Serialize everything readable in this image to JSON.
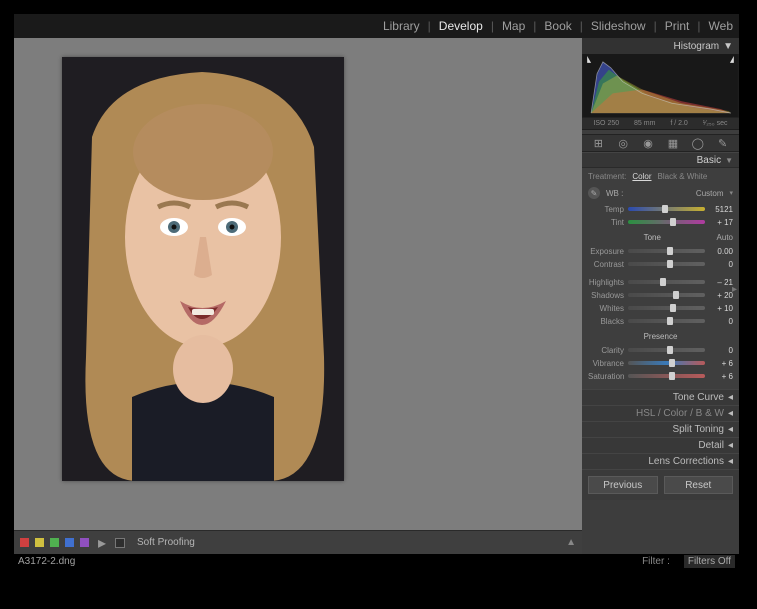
{
  "modules": {
    "library": "Library",
    "develop": "Develop",
    "map": "Map",
    "book": "Book",
    "slideshow": "Slideshow",
    "print": "Print",
    "web": "Web",
    "active": "develop"
  },
  "histogram": {
    "title": "Histogram",
    "meta": {
      "iso": "ISO 250",
      "focal": "85 mm",
      "aperture": "f / 2.0",
      "shutter": "¹⁄₂₅₀ sec"
    }
  },
  "tools": [
    "crop",
    "spot",
    "redeye",
    "grad",
    "radial",
    "brush"
  ],
  "basic": {
    "title": "Basic",
    "treatment": {
      "label": "Treatment:",
      "color": "Color",
      "bw": "Black & White",
      "active": "color"
    },
    "wb": {
      "label": "WB :",
      "preset": "Custom"
    },
    "temp": {
      "label": "Temp",
      "value": "5121",
      "pos": 44
    },
    "tint": {
      "label": "Tint",
      "value": "+ 17",
      "pos": 54
    },
    "tone": {
      "label": "Tone",
      "auto": "Auto"
    },
    "exposure": {
      "label": "Exposure",
      "value": "0.00",
      "pos": 50
    },
    "contrast": {
      "label": "Contrast",
      "value": "0",
      "pos": 50
    },
    "highlights": {
      "label": "Highlights",
      "value": "– 21",
      "pos": 41
    },
    "shadows": {
      "label": "Shadows",
      "value": "+ 20",
      "pos": 58
    },
    "whites": {
      "label": "Whites",
      "value": "+ 10",
      "pos": 54
    },
    "blacks": {
      "label": "Blacks",
      "value": "0",
      "pos": 50
    },
    "presence": {
      "label": "Presence"
    },
    "clarity": {
      "label": "Clarity",
      "value": "0",
      "pos": 50
    },
    "vibrance": {
      "label": "Vibrance",
      "value": "+ 6",
      "pos": 53
    },
    "saturation": {
      "label": "Saturation",
      "value": "+ 6",
      "pos": 53
    }
  },
  "panels": {
    "tonecurve": "Tone Curve",
    "hsl": "HSL / Color / B & W",
    "split": "Split Toning",
    "detail": "Detail",
    "lens": "Lens Corrections"
  },
  "buttons": {
    "previous": "Previous",
    "reset": "Reset"
  },
  "toolbar": {
    "softproof": "Soft Proofing"
  },
  "status": {
    "filename": "A3172-2.dng",
    "filter_label": "Filter :",
    "filter_state": "Filters Off"
  }
}
